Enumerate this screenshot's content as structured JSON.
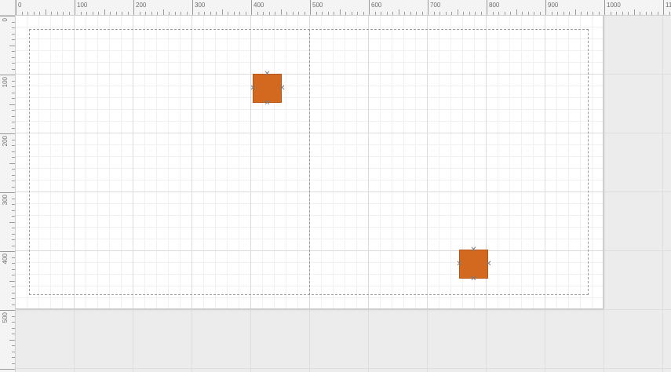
{
  "rulers": {
    "horizontal_labels": [
      "0",
      "100",
      "200",
      "300",
      "400",
      "500",
      "600",
      "700",
      "800",
      "900",
      "1000",
      "11"
    ],
    "vertical_labels": [
      "0",
      "100",
      "200",
      "300",
      "400",
      "500"
    ]
  },
  "canvas": {
    "shape_color": "#d2691e",
    "shapes": [
      {
        "name": "shape-square-top"
      },
      {
        "name": "shape-square-bottom"
      }
    ]
  },
  "icons": {
    "connection_point": "cross-icon"
  }
}
